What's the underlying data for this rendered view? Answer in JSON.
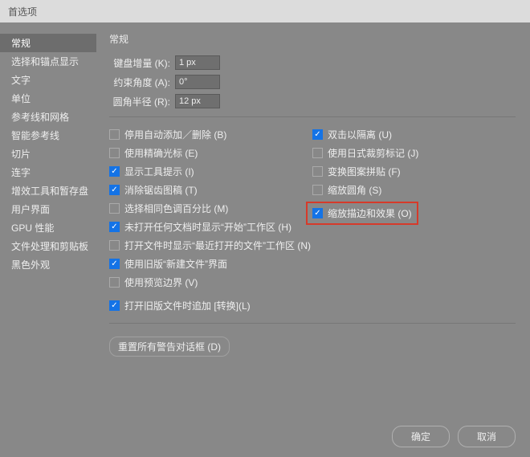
{
  "window": {
    "title": "首选项"
  },
  "sidebar": {
    "items": [
      {
        "label": "常规",
        "selected": true
      },
      {
        "label": "选择和锚点显示",
        "selected": false
      },
      {
        "label": "文字",
        "selected": false
      },
      {
        "label": "单位",
        "selected": false
      },
      {
        "label": "参考线和网格",
        "selected": false
      },
      {
        "label": "智能参考线",
        "selected": false
      },
      {
        "label": "切片",
        "selected": false
      },
      {
        "label": "连字",
        "selected": false
      },
      {
        "label": "增效工具和暂存盘",
        "selected": false
      },
      {
        "label": "用户界面",
        "selected": false
      },
      {
        "label": "GPU 性能",
        "selected": false
      },
      {
        "label": "文件处理和剪贴板",
        "selected": false
      },
      {
        "label": "黑色外观",
        "selected": false
      }
    ]
  },
  "main": {
    "section_title": "常规",
    "fields": {
      "keyboard_increment": {
        "label": "键盘增量 (K):",
        "value": "1 px"
      },
      "constrain_angle": {
        "label": "约束角度 (A):",
        "value": "0°"
      },
      "corner_radius": {
        "label": "圆角半径 (R):",
        "value": "12 px"
      }
    },
    "checks_left": [
      {
        "label": "停用自动添加／删除 (B)",
        "checked": false
      },
      {
        "label": "使用精确光标 (E)",
        "checked": false
      },
      {
        "label": "显示工具提示 (I)",
        "checked": true
      },
      {
        "label": "消除锯齿图稿 (T)",
        "checked": true
      },
      {
        "label": "选择相同色调百分比 (M)",
        "checked": false
      },
      {
        "label": "未打开任何文档时显示“开始”工作区 (H)",
        "checked": true
      },
      {
        "label": "打开文件时显示“最近打开的文件”工作区 (N)",
        "checked": false
      },
      {
        "label": "使用旧版“新建文件”界面",
        "checked": true
      },
      {
        "label": "使用预览边界 (V)",
        "checked": false
      },
      {
        "gap": true
      },
      {
        "label": "打开旧版文件时追加 [转换](L)",
        "checked": true
      }
    ],
    "checks_right": [
      {
        "label": "双击以隔离 (U)",
        "checked": true
      },
      {
        "label": "使用日式裁剪标记 (J)",
        "checked": false
      },
      {
        "label": "变换图案拼贴 (F)",
        "checked": false
      },
      {
        "label": "缩放圆角 (S)",
        "checked": false
      },
      {
        "label": "缩放描边和效果 (O)",
        "checked": true,
        "highlight": true
      }
    ],
    "reset_button": "重置所有警告对话框 (D)"
  },
  "footer": {
    "ok": "确定",
    "cancel": "取消"
  }
}
